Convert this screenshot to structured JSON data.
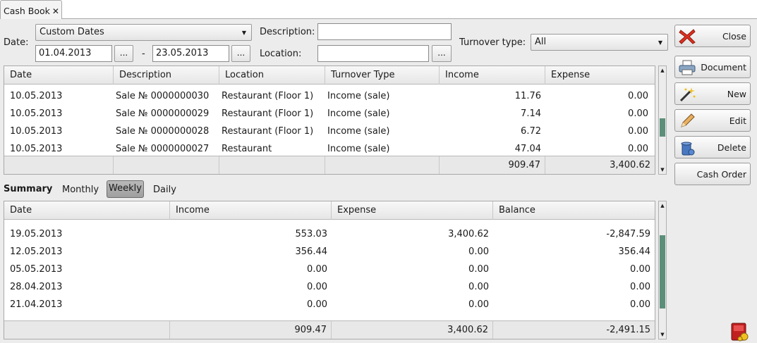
{
  "tab": {
    "title": "Cash Book",
    "close": "✕"
  },
  "filters": {
    "date_label": "Date:",
    "period_value": "Custom Dates",
    "date_from": "01.04.2013",
    "date_sep": "-",
    "date_to": "23.05.2013",
    "dots": "...",
    "description_label": "Description:",
    "description_value": "",
    "location_label": "Location:",
    "location_value": "",
    "turnover_label": "Turnover type:",
    "turnover_value": "All"
  },
  "main_table": {
    "columns": [
      "Date",
      "Description",
      "Location",
      "Turnover Type",
      "Income",
      "Expense"
    ],
    "rows": [
      {
        "date": "10.05.2013",
        "description": "Sale № 0000000030",
        "location": "Restaurant (Floor 1)",
        "type": "Income (sale)",
        "income": "11.76",
        "expense": "0.00"
      },
      {
        "date": "10.05.2013",
        "description": "Sale № 0000000029",
        "location": "Restaurant (Floor 1)",
        "type": "Income (sale)",
        "income": "7.14",
        "expense": "0.00"
      },
      {
        "date": "10.05.2013",
        "description": "Sale № 0000000028",
        "location": "Restaurant (Floor 1)",
        "type": "Income (sale)",
        "income": "6.72",
        "expense": "0.00"
      },
      {
        "date": "10.05.2013",
        "description": "Sale № 0000000027",
        "location": "Restaurant",
        "type": "Income (sale)",
        "income": "47.04",
        "expense": "0.00"
      }
    ],
    "totals": {
      "income": "909.47",
      "expense": "3,400.62"
    }
  },
  "summary": {
    "label": "Summary",
    "modes": {
      "monthly": "Monthly",
      "weekly": "Weekly",
      "daily": "Daily"
    },
    "active_mode": "Weekly",
    "columns": [
      "Date",
      "Income",
      "Expense",
      "Balance"
    ],
    "rows": [
      {
        "date": "19.05.2013",
        "income": "553.03",
        "expense": "3,400.62",
        "balance": "-2,847.59"
      },
      {
        "date": "12.05.2013",
        "income": "356.44",
        "expense": "0.00",
        "balance": "356.44"
      },
      {
        "date": "05.05.2013",
        "income": "0.00",
        "expense": "0.00",
        "balance": "0.00"
      },
      {
        "date": "28.04.2013",
        "income": "0.00",
        "expense": "0.00",
        "balance": "0.00"
      },
      {
        "date": "21.04.2013",
        "income": "0.00",
        "expense": "0.00",
        "balance": "0.00"
      }
    ],
    "totals": {
      "income": "909.47",
      "expense": "3,400.62",
      "balance": "-2,491.15"
    }
  },
  "actions": {
    "close": "Close",
    "document": "Document",
    "new": "New",
    "edit": "Edit",
    "delete": "Delete",
    "cash_order": "Cash Order"
  },
  "icons": {
    "close": "red-x-icon",
    "document": "printer-icon",
    "new": "magic-wand-icon",
    "edit": "pencil-icon",
    "delete": "trash-icon",
    "app": "cash-register-icon"
  },
  "colors": {
    "scroll_thumb": "#5c8f7a",
    "active_mode": "#a8a8a8",
    "close_icon": "#e03020"
  }
}
